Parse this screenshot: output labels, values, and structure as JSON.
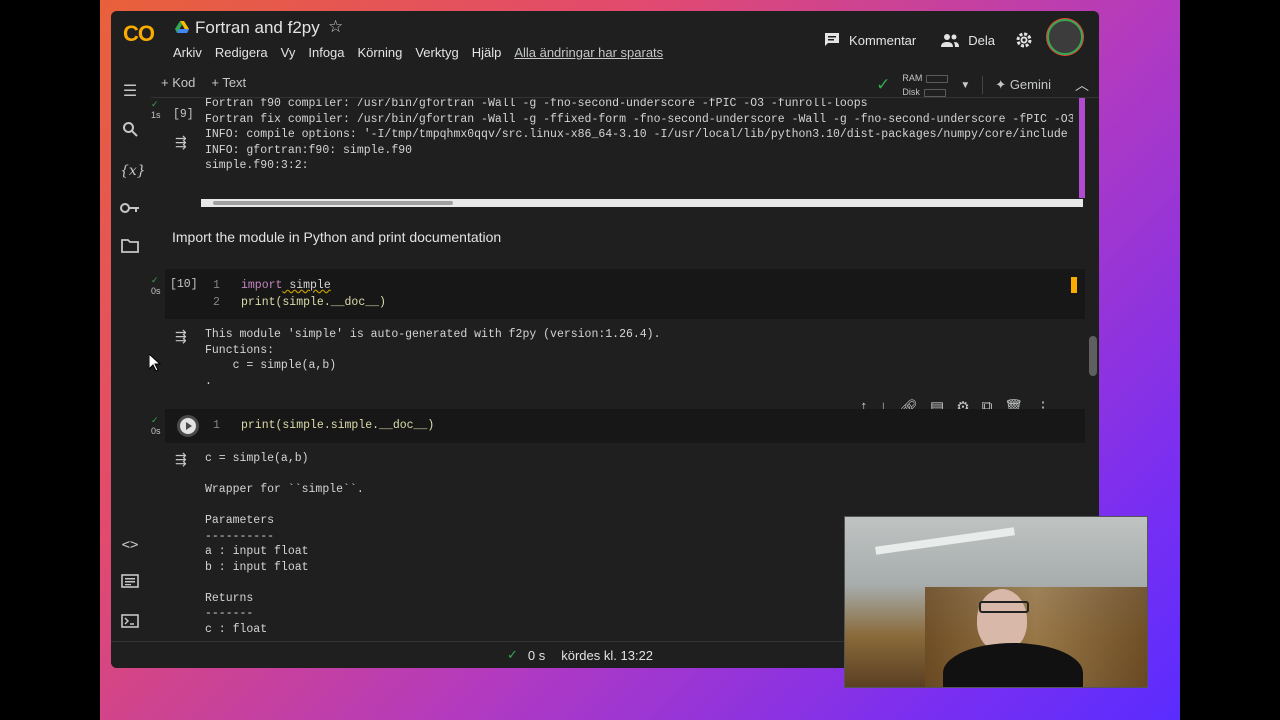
{
  "app": {
    "logo": "CO",
    "title": "Fortran and f2py",
    "menus": [
      "Arkiv",
      "Redigera",
      "Vy",
      "Infoga",
      "Körning",
      "Verktyg",
      "Hjälp"
    ],
    "saved_status": "Alla ändringar har sparats",
    "comment_label": "Kommentar",
    "share_label": "Dela"
  },
  "toolbar": {
    "add_code": "+ Kod",
    "add_text": "+ Text",
    "ram_label": "RAM",
    "disk_label": "Disk",
    "gemini_label": "Gemini"
  },
  "cells": {
    "cell9": {
      "exec_count": "[9]",
      "exec_time": "1s",
      "output": "Fortran f90 compiler: /usr/bin/gfortran -Wall -g -fno-second-underscore -fPIC -O3 -funroll-loops\nFortran fix compiler: /usr/bin/gfortran -Wall -g -ffixed-form -fno-second-underscore -Wall -g -fno-second-underscore -fPIC -O3\nINFO: compile options: '-I/tmp/tmpqhmx0qqv/src.linux-x86_64-3.10 -I/usr/local/lib/python3.10/dist-packages/numpy/core/include -\nINFO: gfortran:f90: simple.f90\nsimple.f90:3:2:"
    },
    "text_cell": "Import the module in Python and print documentation",
    "cell10": {
      "exec_count": "[10]",
      "exec_time": "0s",
      "line1_no": "1",
      "line1_kw": "import",
      "line1_rest": " simple",
      "line2_no": "2",
      "line2": "print(simple.__doc__)",
      "output": "This module 'simple' is auto-generated with f2py (version:1.26.4).\nFunctions:\n    c = simple(a,b)\n."
    },
    "cell11": {
      "exec_time": "0s",
      "line1_no": "1",
      "line1": "print(simple.simple.__doc__)",
      "output": "c = simple(a,b)\n\nWrapper for ``simple``.\n\nParameters\n----------\na : input float\nb : input float\n\nReturns\n-------\nc : float"
    }
  },
  "status": {
    "duration": "0 s",
    "ran_at": "kördes kl. 13:22"
  },
  "colors": {
    "accent_green": "#34a853",
    "background": "#1f1f1f",
    "code_bg": "#171717"
  }
}
